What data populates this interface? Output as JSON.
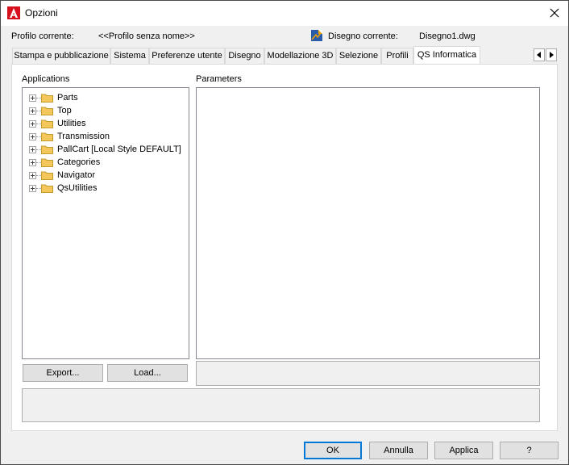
{
  "window": {
    "title": "Opzioni"
  },
  "profile": {
    "label": "Profilo corrente:",
    "value": "<<Profilo senza nome>>"
  },
  "drawing": {
    "label": "Disegno corrente:",
    "value": "Disegno1.dwg"
  },
  "tabs": [
    {
      "label": "Stampa e pubblicazione"
    },
    {
      "label": "Sistema"
    },
    {
      "label": "Preferenze utente"
    },
    {
      "label": "Disegno"
    },
    {
      "label": "Modellazione 3D"
    },
    {
      "label": "Selezione"
    },
    {
      "label": "Profili"
    },
    {
      "label": "QS Informatica"
    }
  ],
  "applications": {
    "label": "Applications",
    "items": [
      "Parts",
      "Top",
      "Utilities",
      "Transmission",
      "PallCart [Local Style DEFAULT]",
      "Categories",
      "Navigator",
      "QsUtilities"
    ]
  },
  "parameters": {
    "label": "Parameters"
  },
  "buttons": {
    "export": "Export...",
    "load": "Load...",
    "ok": "OK",
    "cancel": "Annulla",
    "apply": "Applica",
    "help": "?"
  },
  "colors": {
    "folder": "#f4c75a",
    "accent": "#0078d7",
    "app_icon": "#d7101d"
  }
}
